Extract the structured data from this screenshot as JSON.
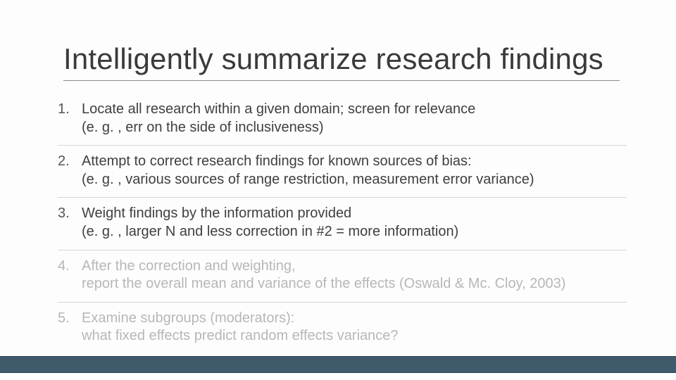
{
  "title": "Intelligently summarize research findings",
  "items": [
    {
      "num": "1.",
      "line1": "Locate all research within a given domain; screen for relevance",
      "line2": "(e. g. , err on the side of inclusiveness)",
      "muted": false
    },
    {
      "num": "2.",
      "line1": "Attempt to correct research findings for known sources of bias:",
      "line2": "(e. g. , various sources of range restriction, measurement error variance)",
      "muted": false
    },
    {
      "num": "3.",
      "line1": "Weight findings by the information provided",
      "line2": "(e. g. , larger N and less correction in #2 = more information)",
      "muted": false
    },
    {
      "num": "4.",
      "line1": "After the correction and weighting,",
      "line2": "report the overall mean and variance of the effects (Oswald & Mc. Cloy, 2003)",
      "muted": true
    },
    {
      "num": "5.",
      "line1": "Examine subgroups (moderators):",
      "line2": "what fixed effects predict random effects variance?",
      "muted": true
    }
  ]
}
